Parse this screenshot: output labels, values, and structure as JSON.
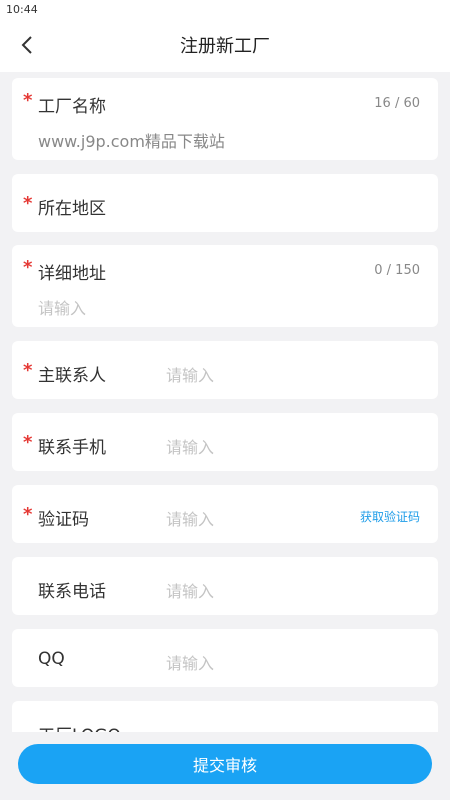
{
  "status_bar": {
    "time": "10:44"
  },
  "nav": {
    "title": "注册新工厂",
    "back_icon": "chevron-left-icon"
  },
  "form": {
    "required_mark": "*",
    "factory_name": {
      "label": "工厂名称",
      "counter": "16 / 60",
      "value": "www.j9p.com精品下载站"
    },
    "region": {
      "label": "所在地区"
    },
    "address": {
      "label": "详细地址",
      "counter": "0 / 150",
      "placeholder": "请输入"
    },
    "contact_person": {
      "label": "主联系人",
      "placeholder": "请输入"
    },
    "mobile": {
      "label": "联系手机",
      "placeholder": "请输入"
    },
    "verify_code": {
      "label": "验证码",
      "placeholder": "请输入",
      "action": "获取验证码"
    },
    "phone": {
      "label": "联系电话",
      "placeholder": "请输入"
    },
    "qq": {
      "label": "QQ",
      "placeholder": "请输入"
    },
    "logo": {
      "label": "工厂LOGO"
    }
  },
  "submit": {
    "label": "提交审核"
  },
  "colors": {
    "accent": "#1aa3f4",
    "required": "#e53935",
    "link": "#1e9ce8",
    "background": "#f2f2f4"
  }
}
